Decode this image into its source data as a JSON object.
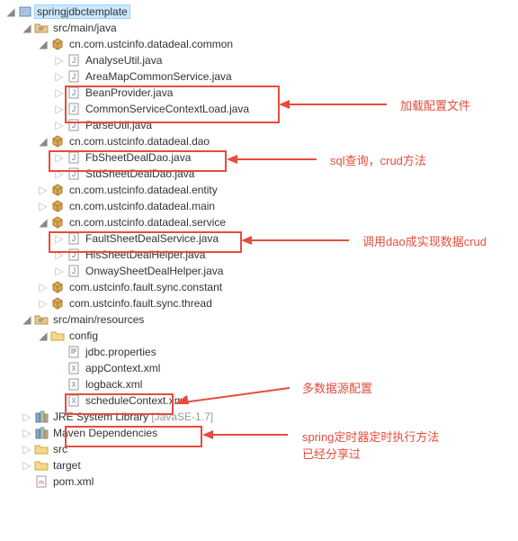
{
  "project": "springjdbctemplate",
  "srcMainJava": "src/main/java",
  "pkgCommon": "cn.com.ustcinfo.datadeal.common",
  "fAnalyseUtil": "AnalyseUtil.java",
  "fAreaMap": "AreaMapCommonService.java",
  "fBeanProvider": "BeanProvider.java",
  "fCommonCtx": "CommonServiceContextLoad.java",
  "fParseUtil": "ParseUtil.java",
  "pkgDao": "cn.com.ustcinfo.datadeal.dao",
  "fFbSheet": "FbSheetDealDao.java",
  "fStdSheet": "StdSheetDealDao.java",
  "pkgEntity": "cn.com.ustcinfo.datadeal.entity",
  "pkgMain": "cn.com.ustcinfo.datadeal.main",
  "pkgService": "cn.com.ustcinfo.datadeal.service",
  "fFaultSheet": "FaultSheetDealService.java",
  "fHisSheet": "HisSheetDealHelper.java",
  "fOnway": "OnwaySheetDealHelper.java",
  "pkgConstant": "com.ustcinfo.fault.sync.constant",
  "pkgThread": "com.ustcinfo.fault.sync.thread",
  "srcMainRes": "src/main/resources",
  "config": "config",
  "fJdbc": "jdbc.properties",
  "fAppCtx": "appContext.xml",
  "fLogback": "logback.xml",
  "fSchedule": "scheduleContext.xml",
  "jre": "JRE System Library",
  "jreVer": "[JavaSE-1.7]",
  "maven": "Maven Dependencies",
  "src": "src",
  "target": "target",
  "pom": "pom.xml",
  "ann1": "加载配置文件",
  "ann2": "sql查询，crud方法",
  "ann3": "调用dao成实现数据crud",
  "ann4": "多数据源配置",
  "ann5": "spring定时器定时执行方法",
  "ann6": "已经分享过"
}
